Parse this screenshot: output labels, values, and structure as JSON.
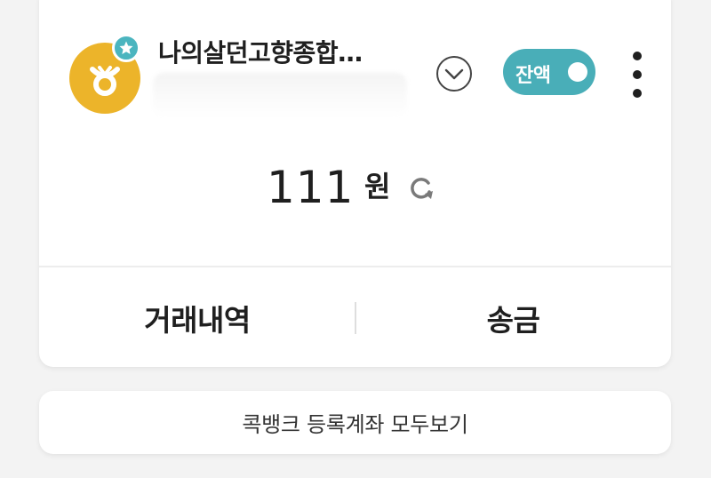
{
  "account": {
    "name": "나의살던고향종합…",
    "bank_color": "#ecb42a",
    "favorite_badge_color": "#4bb5bf"
  },
  "toggle": {
    "label": "잔액",
    "on": true,
    "color": "#49aeb8"
  },
  "balance": {
    "amount": "111",
    "unit": "원"
  },
  "actions": {
    "history_label": "거래내역",
    "transfer_label": "송금"
  },
  "footer": {
    "view_all_label": "콕뱅크 등록계좌 모두보기"
  },
  "icons": {
    "bank": "bank-logo-icon",
    "favorite": "star-icon",
    "expand": "chevron-down-icon",
    "more": "more-vertical-icon",
    "refresh": "refresh-icon"
  }
}
